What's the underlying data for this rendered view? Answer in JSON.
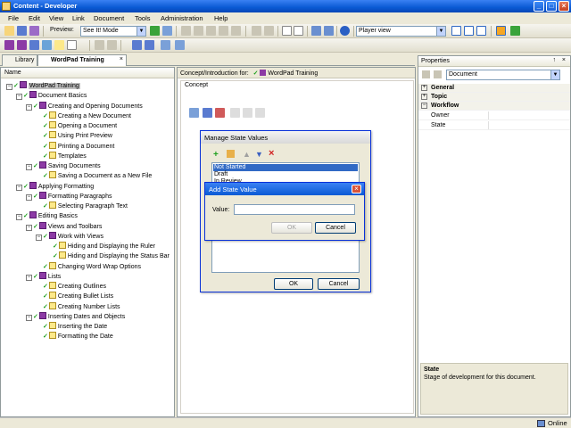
{
  "window": {
    "title": "Content - Developer"
  },
  "menu": [
    "File",
    "Edit",
    "View",
    "Link",
    "Document",
    "Tools",
    "Administration",
    "Help"
  ],
  "toolbar": {
    "preview_label": "Preview:",
    "preview_mode": "See It! Mode",
    "player_view": "Player view"
  },
  "tabs": [
    {
      "label": "Library",
      "active": false
    },
    {
      "label": "WordPad Training",
      "active": true
    }
  ],
  "tree": {
    "header": "Name",
    "nodes": [
      {
        "label": "WordPad Training",
        "kind": "book",
        "level": 0,
        "selected": true
      },
      {
        "label": "Document Basics",
        "kind": "book",
        "level": 1
      },
      {
        "label": "Creating and Opening Documents",
        "kind": "book",
        "level": 2
      },
      {
        "label": "Creating a New Document",
        "kind": "topic",
        "level": 3
      },
      {
        "label": "Opening a Document",
        "kind": "topic",
        "level": 3
      },
      {
        "label": "Using Print Preview",
        "kind": "topic",
        "level": 3
      },
      {
        "label": "Printing a Document",
        "kind": "topic",
        "level": 3
      },
      {
        "label": "Templates",
        "kind": "topic",
        "level": 3
      },
      {
        "label": "Saving Documents",
        "kind": "book",
        "level": 2
      },
      {
        "label": "Saving a Document as a New File",
        "kind": "topic",
        "level": 3
      },
      {
        "label": "Applying Formatting",
        "kind": "book",
        "level": 1
      },
      {
        "label": "Formatting Paragraphs",
        "kind": "book",
        "level": 2
      },
      {
        "label": "Selecting Paragraph Text",
        "kind": "topic",
        "level": 3
      },
      {
        "label": "Editing Basics",
        "kind": "book",
        "level": 1
      },
      {
        "label": "Views and Toolbars",
        "kind": "book",
        "level": 2
      },
      {
        "label": "Work with Views",
        "kind": "book",
        "level": 3
      },
      {
        "label": "Hiding and Displaying the Ruler",
        "kind": "topic",
        "level": 4
      },
      {
        "label": "Hiding and Displaying the Status Bar",
        "kind": "topic",
        "level": 4
      },
      {
        "label": "Changing Word Wrap Options",
        "kind": "topic",
        "level": 3
      },
      {
        "label": "Lists",
        "kind": "book",
        "level": 2
      },
      {
        "label": "Creating Outlines",
        "kind": "topic",
        "level": 3
      },
      {
        "label": "Creating Bullet Lists",
        "kind": "topic",
        "level": 3
      },
      {
        "label": "Creating Number Lists",
        "kind": "topic",
        "level": 3
      },
      {
        "label": "Inserting Dates and Objects",
        "kind": "book",
        "level": 2
      },
      {
        "label": "Inserting the Date",
        "kind": "topic",
        "level": 3
      },
      {
        "label": "Formatting the Date",
        "kind": "topic",
        "level": 3
      }
    ]
  },
  "center": {
    "header_prefix": "Concept/Introduction for:",
    "header_doc": "WordPad Training",
    "concept_label": "Concept"
  },
  "manage_dialog": {
    "title": "Manage State Values",
    "items": [
      "Not Started",
      "Draft",
      "In Review"
    ],
    "ok": "OK",
    "cancel": "Cancel"
  },
  "add_dialog": {
    "title": "Add State Value",
    "value_label": "Value:",
    "value": "",
    "ok": "OK",
    "cancel": "Cancel"
  },
  "properties": {
    "title": "Properties",
    "pin": "↑",
    "close": "×",
    "selector": "Document",
    "groups": [
      {
        "label": "General",
        "expanded": false
      },
      {
        "label": "Topic",
        "expanded": false
      },
      {
        "label": "Workflow",
        "expanded": true
      }
    ],
    "rows": [
      "Owner",
      "State"
    ],
    "desc_title": "State",
    "desc_text": "Stage of development for this document."
  },
  "status": {
    "text": "Online"
  },
  "colors": {
    "accent": "#0a5ad4",
    "selection": "#316ac5",
    "tick": "#1ea01e",
    "book": "#8c3aa5"
  }
}
